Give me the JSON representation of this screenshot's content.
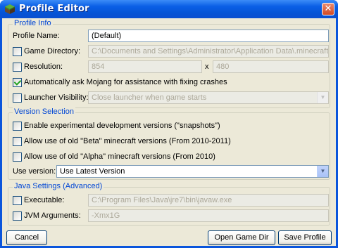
{
  "window": {
    "title": "Profile Editor",
    "close_glyph": "✕",
    "app_icon": "minecraft-block-icon",
    "colors": {
      "titlebar": "#0a55dc",
      "client": "#ece9d8",
      "group_title": "#0046d5"
    }
  },
  "profile_info": {
    "title": "Profile Info",
    "profile_name_label": "Profile Name:",
    "profile_name_value": "(Default)",
    "game_directory_label": "Game Directory:",
    "game_directory_value": "C:\\Documents and Settings\\Administrator\\Application Data\\.minecraft",
    "game_directory_checked": false,
    "resolution_label": "Resolution:",
    "resolution_width": "854",
    "resolution_times": "x",
    "resolution_height": "480",
    "resolution_checked": false,
    "auto_mojang_label": "Automatically ask Mojang for assistance with fixing crashes",
    "auto_mojang_checked": true,
    "launcher_visibility_label": "Launcher Visibility:",
    "launcher_visibility_value": "Close launcher when game starts",
    "launcher_visibility_checked": false
  },
  "version_selection": {
    "title": "Version Selection",
    "snapshots_label": "Enable experimental development versions (\"snapshots\")",
    "snapshots_checked": false,
    "beta_label": "Allow use of old \"Beta\" minecraft versions (From 2010-2011)",
    "beta_checked": false,
    "alpha_label": "Allow use of old \"Alpha\" minecraft versions (From 2010)",
    "alpha_checked": false,
    "use_version_label": "Use version:",
    "use_version_value": "Use Latest Version"
  },
  "java_settings": {
    "title": "Java Settings (Advanced)",
    "executable_label": "Executable:",
    "executable_value": "C:\\Program Files\\Java\\jre7\\bin\\javaw.exe",
    "executable_checked": false,
    "jvm_arguments_label": "JVM Arguments:",
    "jvm_arguments_value": "-Xmx1G",
    "jvm_arguments_checked": false
  },
  "buttons": {
    "cancel": "Cancel",
    "open_game_dir": "Open Game Dir",
    "save_profile": "Save Profile"
  }
}
